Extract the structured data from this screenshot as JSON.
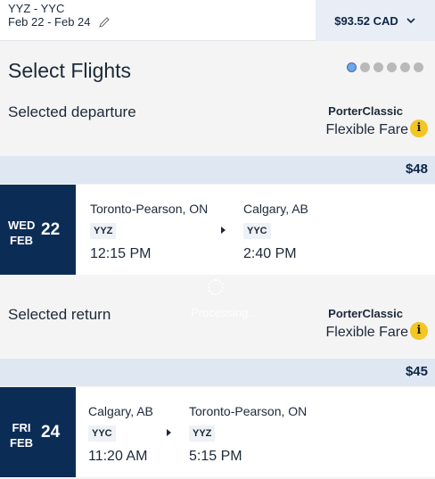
{
  "header": {
    "route": "YYZ - YYC",
    "dates": "Feb 22 - Feb 24",
    "total_price": "$93.52 CAD"
  },
  "page": {
    "title": "Select Flights",
    "progress_steps": 6,
    "active_step": 1,
    "processing_text": "Processing..."
  },
  "departure": {
    "label": "Selected departure",
    "fare_brand": "PorterClassic",
    "fare_type": "Flexible Fare",
    "price": "$48",
    "weekday": "WED",
    "month": "FEB",
    "day": "22",
    "origin_city": "Toronto-Pearson, ON",
    "origin_code": "YYZ",
    "depart_time": "12:15 PM",
    "dest_city": "Calgary, AB",
    "dest_code": "YYC",
    "arrive_time": "2:40 PM"
  },
  "return": {
    "label": "Selected return",
    "fare_brand": "PorterClassic",
    "fare_type": "Flexible Fare",
    "price": "$45",
    "weekday": "FRI",
    "month": "FEB",
    "day": "24",
    "origin_city": "Calgary, AB",
    "origin_code": "YYC",
    "depart_time": "11:20 AM",
    "dest_city": "Toronto-Pearson, ON",
    "dest_code": "YYZ",
    "arrive_time": "5:15 PM"
  },
  "icons": {
    "info": "i"
  },
  "colors": {
    "navy": "#0b2d55",
    "info_yellow": "#f3c623",
    "price_bar": "#dfe7f2",
    "active_dot": "#6fa6e8"
  }
}
